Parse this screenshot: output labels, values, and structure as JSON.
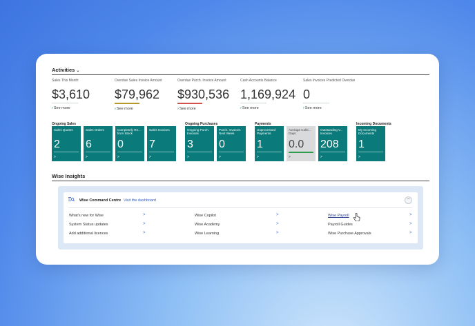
{
  "activities": {
    "title": "Activities",
    "kpis": [
      {
        "label": "Sales This Month",
        "value": "$3,610",
        "bar_color": "",
        "more": "See more"
      },
      {
        "label": "Overdue Sales Invoice Amount",
        "value": "$79,962",
        "bar_color": "#b59a2b",
        "more": "See more"
      },
      {
        "label": "Overdue Purch. Invoice Amount",
        "value": "$930,536",
        "bar_color": "#d4514b",
        "more": "See more"
      },
      {
        "label": "Cash Accounts Balance",
        "value": "1,169,924",
        "bar_color": "",
        "more": "See more"
      },
      {
        "label": "Sales Invoices Predicted Overdue",
        "value": "0",
        "bar_color": "",
        "more": "See more"
      }
    ],
    "groups": [
      {
        "title": "Ongoing Sales",
        "tiles": [
          {
            "label": "Sales Quotes",
            "value": "2"
          },
          {
            "label": "Sales Orders",
            "value": "6"
          },
          {
            "label": "Completely Re... from Stock",
            "value": "0"
          },
          {
            "label": "Sales Invoices",
            "value": "7"
          }
        ]
      },
      {
        "title": "Ongoing Purchases",
        "tiles": [
          {
            "label": "Ongoing Purch. Invoices",
            "value": "3"
          },
          {
            "label": "Purch. Invoices Next Week",
            "value": "0"
          }
        ]
      },
      {
        "title": "Payments",
        "tiles": [
          {
            "label": "Unprocessed Payments",
            "value": "1"
          },
          {
            "label": "Average Colle... Days",
            "value": "0.0"
          },
          {
            "label": "Outstanding V... Invoices",
            "value": "208"
          }
        ]
      },
      {
        "title": "Incoming Documents",
        "tiles": [
          {
            "label": "My Incoming Documents",
            "value": "1"
          }
        ]
      }
    ],
    "tile_arrow": ">",
    "colors": {
      "tile": "#0a7a7a",
      "tile_gray": "#d8dadb",
      "accent_green": "#2e9b4e"
    }
  },
  "insights": {
    "title": "Wise Insights",
    "command_centre": {
      "title": "Wise Command Centre",
      "link": "Visit the dashboard",
      "collapse": "−",
      "icon": "list-search-icon",
      "columns": [
        [
          "What's new for Wise",
          "System Status updates",
          "Add additional licences"
        ],
        [
          "Wise Copilot",
          "Wise Academy",
          "Wise Learning"
        ],
        [
          "Wise Payroll",
          "Payroll Guides",
          "Wise Purchase Approvals"
        ]
      ],
      "arrow": ">"
    }
  }
}
